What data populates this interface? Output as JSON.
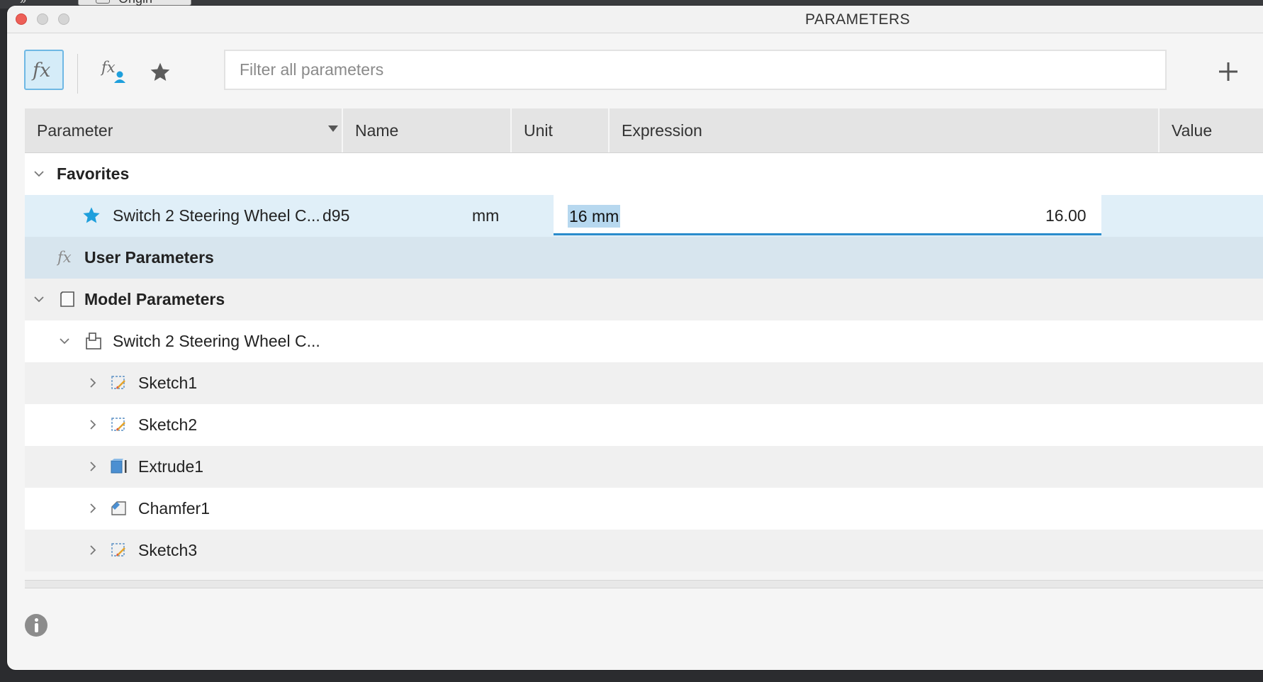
{
  "window": {
    "title": "PARAMETERS",
    "background_tab_label": "Origin"
  },
  "toolbar": {
    "all_parameters_icon": "fx-icon",
    "user_parameters_icon": "fx-user-icon",
    "favorites_icon": "star-icon",
    "filter_placeholder": "Filter all parameters",
    "filter_value": "",
    "add_icon": "plus-icon"
  },
  "table": {
    "columns": {
      "parameter": "Parameter",
      "name": "Name",
      "unit": "Unit",
      "expression": "Expression",
      "value": "Value"
    },
    "favorites": {
      "label": "Favorites",
      "expanded": true,
      "rows": [
        {
          "parameter": "Switch 2 Steering Wheel C...",
          "name": "d95",
          "unit": "mm",
          "expression": "16 mm",
          "value": "16.00",
          "favorite": true
        }
      ]
    },
    "user_parameters": {
      "label": "User Parameters"
    },
    "model_parameters": {
      "label": "Model Parameters",
      "expanded": true,
      "component": {
        "label": "Switch 2 Steering Wheel C...",
        "expanded": true,
        "features": [
          {
            "label": "Sketch1",
            "icon": "sketch-icon"
          },
          {
            "label": "Sketch2",
            "icon": "sketch-icon"
          },
          {
            "label": "Extrude1",
            "icon": "extrude-icon"
          },
          {
            "label": "Chamfer1",
            "icon": "chamfer-icon"
          },
          {
            "label": "Sketch3",
            "icon": "sketch-icon"
          }
        ]
      }
    }
  },
  "colors": {
    "accent_blue": "#2a8ccc",
    "favorite_star": "#1e9fdc",
    "selected_row": "#e0eff8",
    "user_row": "#d7e5ee"
  }
}
